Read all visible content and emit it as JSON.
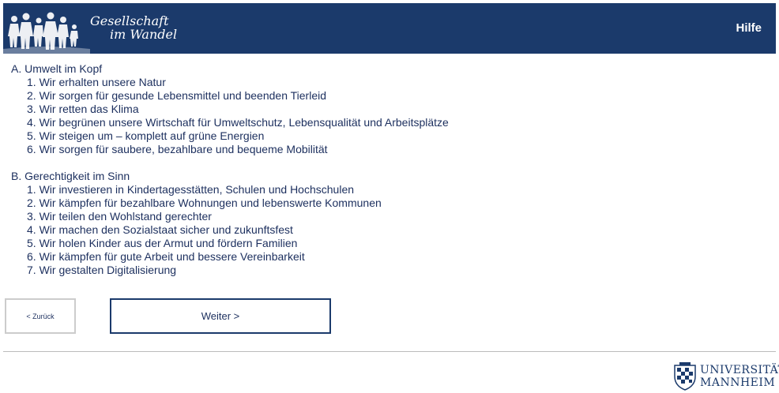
{
  "header": {
    "logo_line1": "Gesellschaft",
    "logo_line2": "im Wandel",
    "help_label": "Hilfe"
  },
  "sections": [
    {
      "heading": "A. Umwelt im Kopf",
      "items": [
        "1. Wir erhalten unsere Natur",
        "2. Wir sorgen für gesunde Lebensmittel und beenden Tierleid",
        "3. Wir retten das Klima",
        "4. Wir begrünen unsere Wirtschaft für Umweltschutz, Lebensqualität und Arbeitsplätze",
        "5. Wir steigen um – komplett auf grüne Energien",
        "6. Wir sorgen für saubere, bezahlbare und bequeme Mobilität"
      ]
    },
    {
      "heading": "B. Gerechtigkeit im Sinn",
      "items": [
        "1. Wir investieren in Kindertagesstätten, Schulen und Hochschulen",
        "2. Wir kämpfen für bezahlbare Wohnungen und lebenswerte Kommunen",
        "3. Wir teilen den Wohlstand gerechter",
        "4. Wir machen den Sozialstaat sicher und zukunftsfest",
        "5. Wir holen Kinder aus der Armut und fördern Familien",
        "6. Wir kämpfen für gute Arbeit und bessere Vereinbarkeit",
        "7. Wir gestalten Digitalisierung"
      ]
    }
  ],
  "nav": {
    "back_label": "< Zurück",
    "next_label": "Weiter >"
  },
  "footer": {
    "uni_line1": "UNIVERSITÄT",
    "uni_line2": "MANNHEIM"
  },
  "colors": {
    "header_bg": "#1b3a6b",
    "text": "#1c2f5e"
  }
}
